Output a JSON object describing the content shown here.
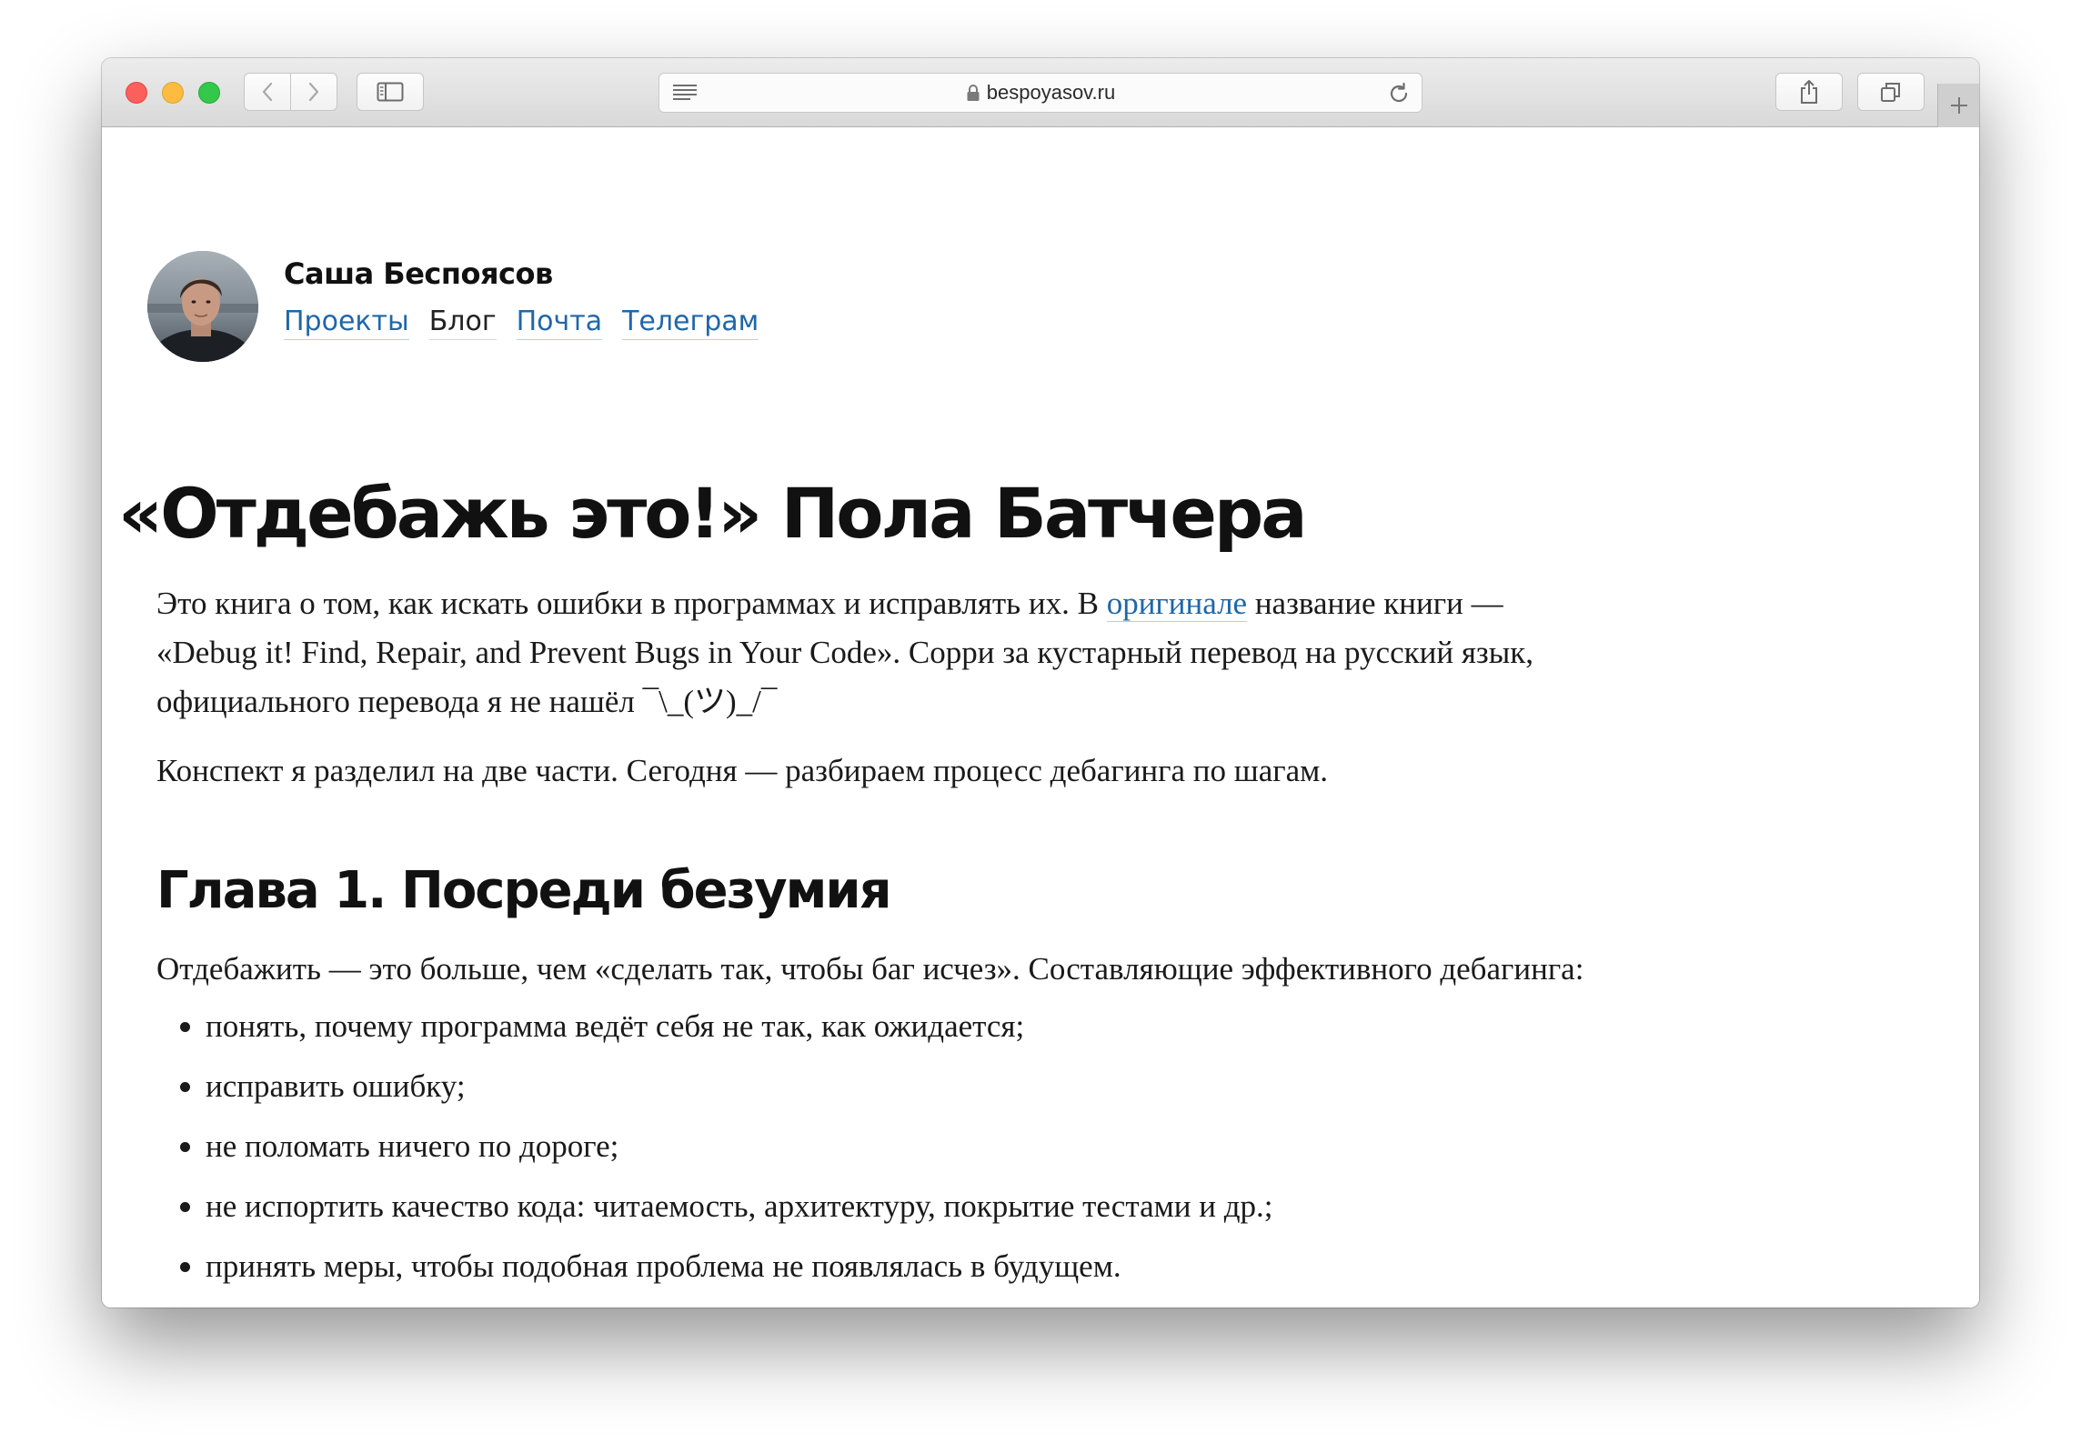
{
  "browser": {
    "url": "bespoyasov.ru",
    "icons": {
      "back": "chevron-left-icon",
      "forward": "chevron-right-icon",
      "sidebar": "sidebar-icon",
      "reader": "reader-icon",
      "lock": "lock-icon",
      "reload": "reload-icon",
      "share": "share-icon",
      "tabs": "tabs-icon",
      "new_tab": "plus-icon"
    }
  },
  "header": {
    "author": "Саша Беспоясов",
    "nav": [
      {
        "label": "Проекты",
        "link": true
      },
      {
        "label": "Блог",
        "link": false
      },
      {
        "label": "Почта",
        "link": true
      },
      {
        "label": "Телеграм",
        "link": true
      }
    ]
  },
  "article": {
    "title": "«Отдебажь это!» Пола Батчера",
    "intro_before_link": "Это книга о том, как искать ошибки в программах и исправлять их. В ",
    "intro_link": "оригинале",
    "intro_after_link": " название книги — «Debug it! Find, Repair, and Prevent Bugs in Your Code». Сорри за кустарный перевод на русский язык, официального перевода я не нашёл ¯\\_(ツ)_/¯",
    "paragraph2": "Конспект я разделил на две части. Сегодня — разбираем процесс дебагинга по шагам.",
    "chapter_title": "Глава 1. Посреди безумия",
    "chapter_intro": "Отдебажить — это больше, чем «сделать так, чтобы баг исчез». Составляющие эффективного дебагинга:",
    "bullets": [
      "понять, почему программа ведёт себя не так, как ожидается;",
      "исправить ошибку;",
      "не поломать ничего по дороге;",
      "не испортить качество кода: читаемость, архитектуру, покрытие тестами и др.;",
      "принять меры, чтобы подобная проблема не появлялась в будущем."
    ]
  },
  "colors": {
    "link": "#1f67a8",
    "text": "#1a1a1a"
  }
}
